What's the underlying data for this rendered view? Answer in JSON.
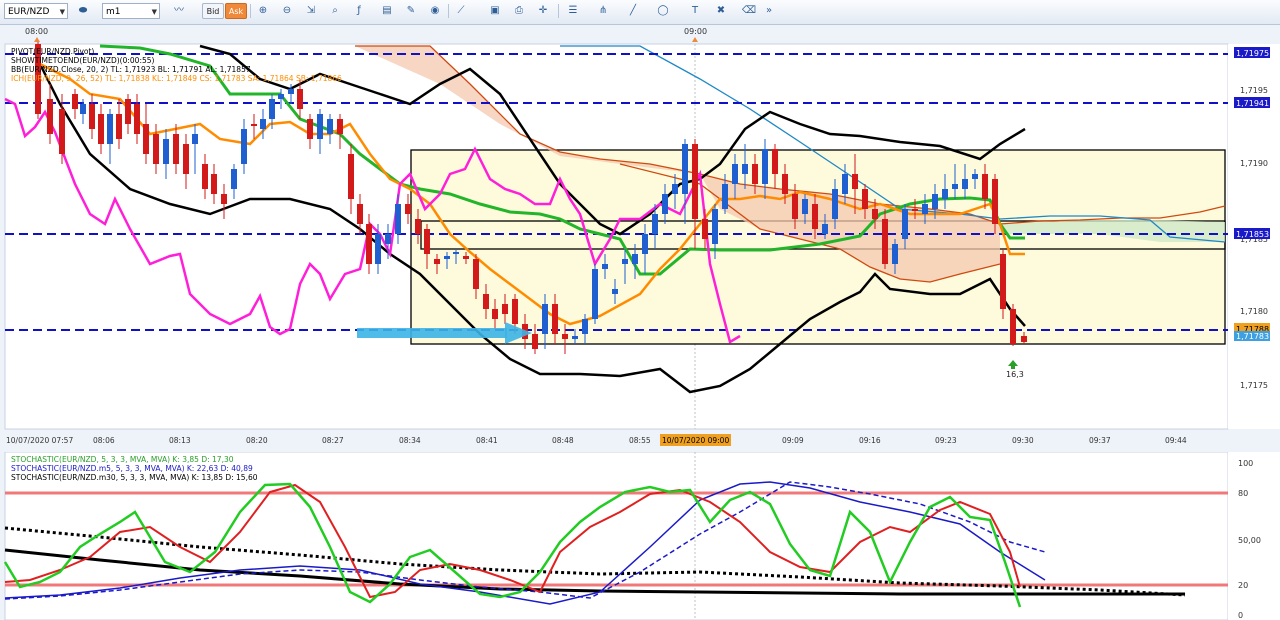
{
  "toolbar": {
    "symbol": "EUR/NZD",
    "timeframe": "m1",
    "bid_label": "Bid",
    "ask_label": "Ask"
  },
  "time_top": [
    "08:00",
    "09:00"
  ],
  "legend": [
    "PIVOT(EUR/NZD.Pivot)",
    "SHOWTIMETOEND(EUR/NZD)(0:00:55)",
    "BB(EUR/NZD.Close, 20, 2)  TL: 1,71923  BL: 1,71791  AL: 1,71857",
    "ICH(EUR/NZD, 9, 26, 52)  TL: 1,71838  KL: 1,71849  CS: 1,71783  SA: 1,71864  SB: 1,71866"
  ],
  "price_ticks": [
    "1,7195",
    "1,7190",
    "1,7185",
    "1,7180",
    "1,7175"
  ],
  "price_tags": [
    {
      "label": "1,71975",
      "color": "#1a1ac8"
    },
    {
      "label": "1,71941",
      "color": "#1a1ac8"
    },
    {
      "label": "1,71853",
      "color": "#1a1ac8"
    },
    {
      "label": "1,71788",
      "color": "#f0a020"
    },
    {
      "label": "1,71783",
      "color": "#3ea0e0"
    }
  ],
  "time_ticks": [
    "10/07/2020 07:57",
    "08:06",
    "08:13",
    "08:20",
    "08:27",
    "08:34",
    "08:41",
    "08:48",
    "08:55",
    "10/07/2020 09:00",
    "09:09",
    "09:16",
    "09:23",
    "09:30",
    "09:37",
    "09:44"
  ],
  "volume_label": "16,3",
  "stoch_legend": [
    {
      "text": "STOCHASTIC(EUR/NZD, 5, 3, 3, MVA, MVA)  K: 3,85  D: 17,30",
      "color": "#2aa02a"
    },
    {
      "text": "STOCHASTIC(EUR/NZD.m5, 5, 3, 3, MVA, MVA)  K: 22,63  D: 40,89",
      "color": "#1a1ac8"
    },
    {
      "text": "STOCHASTIC(EUR/NZD.m30, 5, 3, 3, MVA, MVA)  K: 13,85  D: 15,60",
      "color": "#000000"
    }
  ],
  "stoch_ticks": [
    "100",
    "80",
    "50,00",
    "20",
    "0"
  ],
  "colors": {
    "bull": "#1f5fd0",
    "bear": "#d21a1a",
    "pivot": "#1010c8",
    "bollinger": "#000000",
    "tenkan": "#ff8c00",
    "kijun": "#22b52a",
    "chikou": "#ff1fd8",
    "senkou_a": "#d04a10",
    "senkou_b": "#1e88c8",
    "stoch_k": "#22cc22",
    "stoch_d": "#e02020"
  }
}
